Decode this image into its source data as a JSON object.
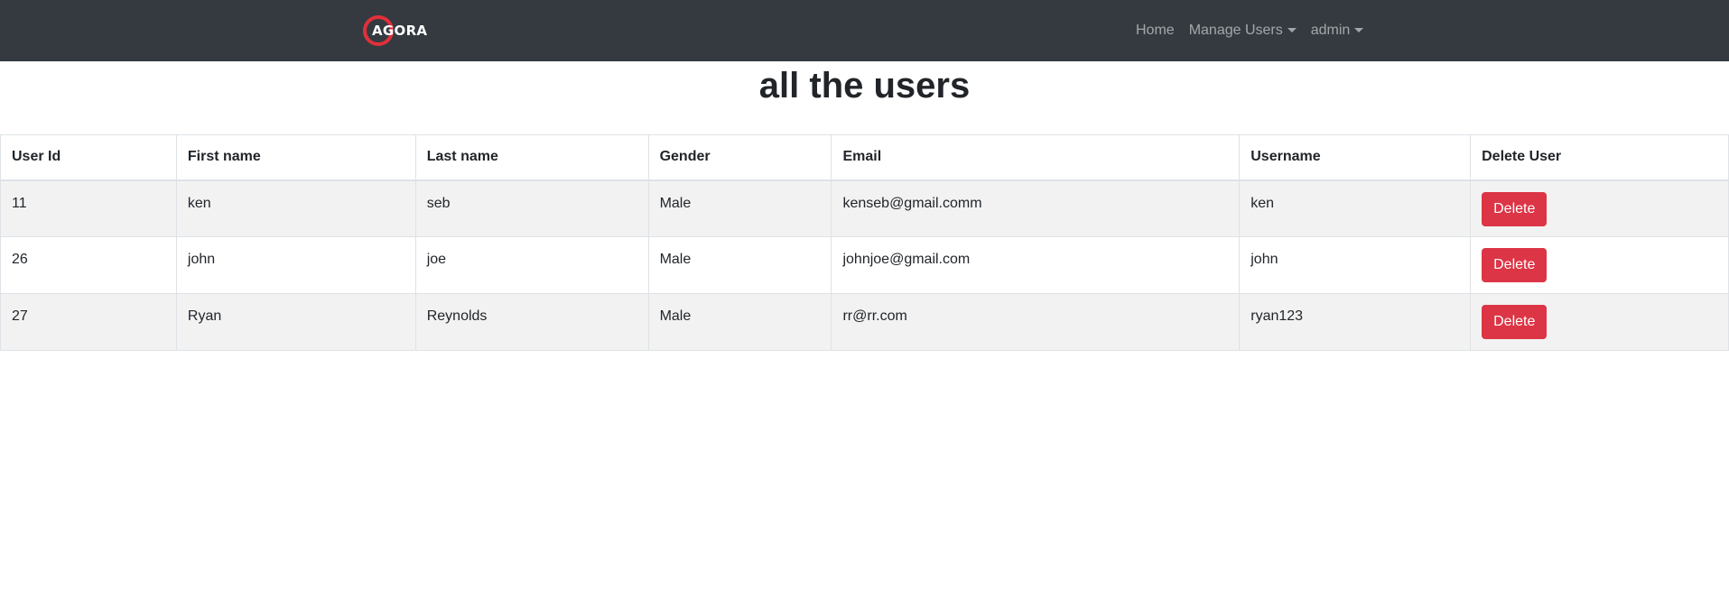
{
  "navbar": {
    "brand": "AGORA",
    "links": {
      "home": "Home",
      "manage_users": "Manage Users",
      "admin": "admin"
    }
  },
  "page": {
    "title": "all the users"
  },
  "table": {
    "headers": [
      "User Id",
      "First name",
      "Last name",
      "Gender",
      "Email",
      "Username",
      "Delete User"
    ],
    "rows": [
      {
        "id": "11",
        "first": "ken",
        "last": "seb",
        "gender": "Male",
        "email": "kenseb@gmail.comm",
        "username": "ken",
        "action": "Delete"
      },
      {
        "id": "26",
        "first": "john",
        "last": "joe",
        "gender": "Male",
        "email": "johnjoe@gmail.com",
        "username": "john",
        "action": "Delete"
      },
      {
        "id": "27",
        "first": "Ryan",
        "last": "Reynolds",
        "gender": "Male",
        "email": "rr@rr.com",
        "username": "ryan123",
        "action": "Delete"
      }
    ]
  },
  "colors": {
    "navbar_bg": "#343a40",
    "danger": "#dc3545",
    "logo_ring": "#e0303a",
    "stripe": "#f2f2f2"
  },
  "icons": {
    "brand_logo": "agora-logo-icon",
    "dropdown": "caret-down-icon"
  }
}
